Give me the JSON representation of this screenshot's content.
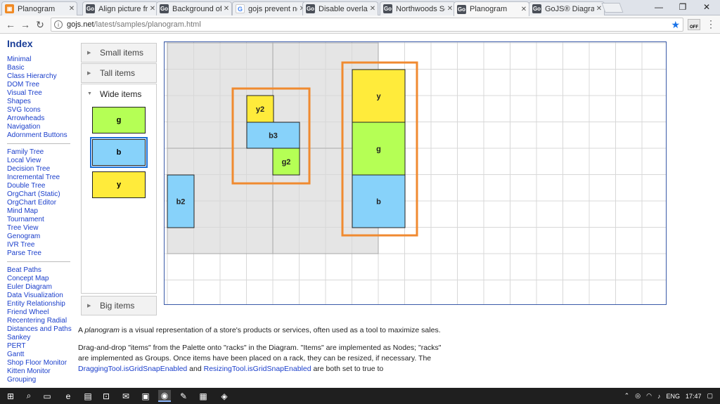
{
  "tabs": [
    {
      "title": "Planogram",
      "icon": "orange",
      "active": false
    },
    {
      "title": "Align picture fr",
      "icon": "go",
      "active": false
    },
    {
      "title": "Background of",
      "icon": "go",
      "active": false
    },
    {
      "title": "gojs prevent no",
      "icon": "google",
      "active": false
    },
    {
      "title": "Disable overlap",
      "icon": "go",
      "active": false
    },
    {
      "title": "Northwoods Sc",
      "icon": "go",
      "active": false
    },
    {
      "title": "Planogram",
      "icon": "go",
      "active": true
    },
    {
      "title": "GoJS® Diagram",
      "icon": "go",
      "active": false
    }
  ],
  "window": {
    "minimize": "—",
    "restore": "❐",
    "close": "✕"
  },
  "address": {
    "host": "gojs.net",
    "path": "/latest/samples/planogram.html",
    "ext_label": "OFF"
  },
  "index": {
    "title": "Index",
    "groups": [
      [
        "Minimal",
        "Basic",
        "Class Hierarchy",
        "DOM Tree",
        "Visual Tree",
        "Shapes",
        "SVG Icons",
        "Arrowheads",
        "Navigation",
        "Adornment Buttons"
      ],
      [
        "Family Tree",
        "Local View",
        "Decision Tree",
        "Incremental Tree",
        "Double Tree",
        "OrgChart (Static)",
        "OrgChart Editor",
        "Mind Map",
        "Tournament",
        "Tree View",
        "Genogram",
        "IVR Tree",
        "Parse Tree"
      ],
      [
        "Beat Paths",
        "Concept Map",
        "Euler Diagram",
        "Data Visualization",
        "Entity Relationship",
        "Friend Wheel",
        "Recentering Radial",
        "Distances and Paths",
        "Sankey",
        "PERT",
        "Gantt",
        "Shop Floor Monitor",
        "Kitten Monitor",
        "Grouping"
      ]
    ]
  },
  "palette": {
    "small_items": "Small items",
    "tall_items": "Tall items",
    "wide_items": "Wide items",
    "big_items": "Big items",
    "items": [
      {
        "text": "g",
        "color": "#b5ff55",
        "selected": false
      },
      {
        "text": "b",
        "color": "#87d2fa",
        "selected": true
      },
      {
        "text": "y",
        "color": "#ffeb3b",
        "selected": false
      }
    ]
  },
  "diagram": {
    "colors": {
      "green": "#b5ff55",
      "blue": "#87d2fa",
      "yellow": "#ffeb3b",
      "rack": "#e5e5e5",
      "highlight": "#f08a30"
    },
    "nodes": [
      {
        "text": "b2",
        "color": "blue"
      },
      {
        "text": "y2",
        "color": "yellow"
      },
      {
        "text": "g2",
        "color": "green"
      },
      {
        "text": "b3",
        "color": "blue"
      },
      {
        "text": "y",
        "color": "yellow"
      },
      {
        "text": "g",
        "color": "green"
      },
      {
        "text": "b",
        "color": "blue"
      }
    ]
  },
  "desc": {
    "p1_a": "A ",
    "p1_em": "planogram",
    "p1_b": " is a visual representation of a store's products or services, often used as a tool to maximize sales.",
    "p2_a": "Drag-and-drop \"items\" from the Palette onto \"racks\" in the Diagram. \"Items\" are implemented as Nodes; \"racks\" are implemented as Groups. Once items have been placed on a rack, they can be resized, if necessary. The ",
    "p2_link1": "DraggingTool.isGridSnapEnabled",
    "p2_b": " and ",
    "p2_link2": "ResizingTool.isGridSnapEnabled",
    "p2_c": " are both set to true to"
  },
  "tray": {
    "lang": "ENG",
    "time": "17:47"
  }
}
